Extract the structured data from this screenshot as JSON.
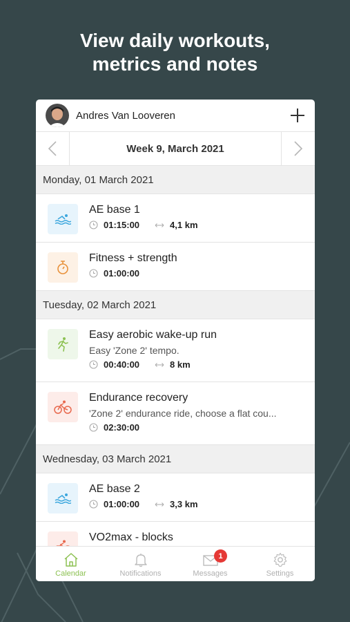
{
  "headline": [
    "View daily workouts,",
    "metrics and notes"
  ],
  "user": {
    "name": "Andres Van Looveren"
  },
  "week": {
    "title": "Week 9, March 2021"
  },
  "days": [
    {
      "label": "Monday, 01 March 2021",
      "workouts": [
        {
          "sport": "swim-icon",
          "title": "AE base 1",
          "duration": "01:15:00",
          "distance": "4,1 km"
        },
        {
          "sport": "stopwatch-icon",
          "title": "Fitness + strength",
          "duration": "01:00:00"
        }
      ]
    },
    {
      "label": "Tuesday, 02 March 2021",
      "workouts": [
        {
          "sport": "run-icon",
          "title": "Easy aerobic wake-up run",
          "description": "Easy 'Zone 2' tempo.",
          "duration": "00:40:00",
          "distance": "8 km"
        },
        {
          "sport": "bike-icon",
          "title": "Endurance recovery",
          "description": "'Zone 2' endurance ride, choose a flat cou...",
          "duration": "02:30:00"
        }
      ]
    },
    {
      "label": "Wednesday, 03 March 2021",
      "workouts": [
        {
          "sport": "swim-icon",
          "title": "AE base 2",
          "duration": "01:00:00",
          "distance": "3,3 km"
        },
        {
          "sport": "bike-icon",
          "title": "VO2max - blocks"
        }
      ]
    }
  ],
  "tabs": [
    {
      "label": "Calendar",
      "icon": "home-icon",
      "active": true
    },
    {
      "label": "Notifications",
      "icon": "bell-icon"
    },
    {
      "label": "Messages",
      "icon": "envelope-icon",
      "badge": "1"
    },
    {
      "label": "Settings",
      "icon": "gear-icon"
    }
  ],
  "colors": {
    "background": "#36474a",
    "accent": "#8cc152",
    "badge": "#e53935",
    "swim": "#3aa6dd",
    "fitness": "#e8913a",
    "run": "#8cc152",
    "bike": "#e8684d"
  }
}
